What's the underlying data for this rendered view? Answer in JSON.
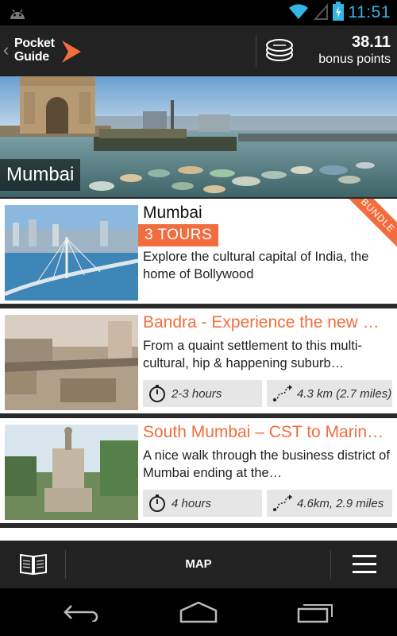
{
  "status_bar": {
    "time": "11:51"
  },
  "app_bar": {
    "logo_line1": "Pocket",
    "logo_line2": "Guide",
    "points_value": "38.11",
    "points_label": "bonus points"
  },
  "hero": {
    "city": "Mumbai"
  },
  "tours": [
    {
      "title": "Mumbai",
      "badge": "3 TOURS",
      "corner_label": "BUNDLE",
      "description": "Explore the cultural capital of India, the home of Bollywood"
    },
    {
      "title": "Bandra - Experience the new Mumbai",
      "description": "From a quaint settlement to this multi-cultural, hip & happening suburb…",
      "duration": "2-3 hours",
      "distance": "4.3 km (2.7 miles)"
    },
    {
      "title": "South Mumbai – CST to Marine Drive",
      "description": "A nice walk through the business district of Mumbai ending at the…",
      "duration": "4 hours",
      "distance": "4.6km, 2.9 miles"
    }
  ],
  "toolbar": {
    "map_label": "MAP"
  },
  "colors": {
    "accent": "#f26d3d",
    "status_blue": "#33b5e5",
    "bar": "#222222"
  }
}
